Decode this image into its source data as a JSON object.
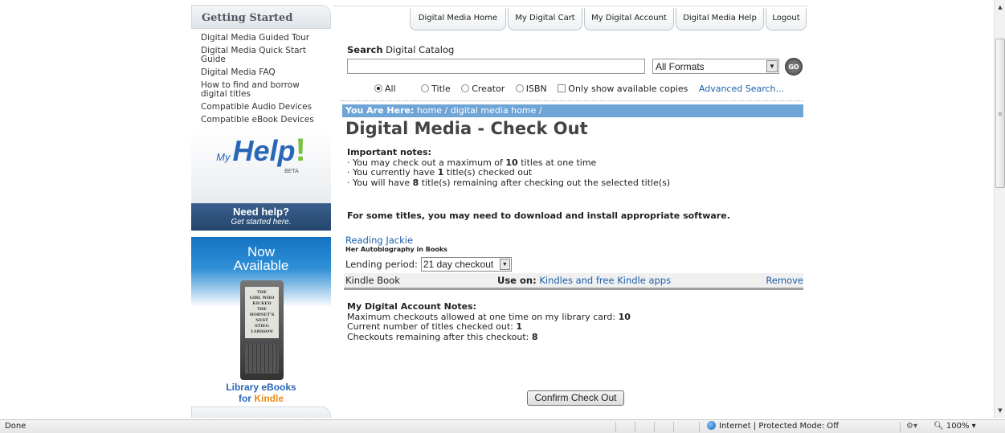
{
  "sidebar": {
    "getting_started_title": "Getting Started",
    "links": [
      "Digital Media Guided Tour",
      "Digital Media Quick Start Guide",
      "Digital Media FAQ",
      "How to find and borrow digital titles",
      "Compatible Audio Devices",
      "Compatible eBook Devices"
    ],
    "myhelp": {
      "my": "My",
      "help": "Help",
      "bang": "!",
      "beta": "BETA",
      "need_help": "Need help?",
      "get_started": "Get started here."
    },
    "kindle_ad": {
      "now": "Now",
      "available": "Available",
      "book_lines": [
        "THE",
        "GIRL WHO",
        "KICKED",
        "THE HORNET'S",
        "NEST",
        "STIEG LARSSON"
      ],
      "library_ebooks": "Library eBooks",
      "for": "for ",
      "kindle": "Kindle"
    }
  },
  "nav_tabs": [
    "Digital Media Home",
    "My Digital Cart",
    "My Digital Account",
    "Digital Media Help",
    "Logout"
  ],
  "search": {
    "label_bold": "Search",
    "label_rest": " Digital Catalog",
    "value": "",
    "format": "All Formats",
    "go": "GO",
    "options": {
      "all": "All",
      "title": "Title",
      "creator": "Creator",
      "isbn": "ISBN"
    },
    "available_only": "Only show available copies",
    "advanced": "Advanced Search..."
  },
  "breadcrumb": {
    "prefix": "You Are Here:",
    "path": " home / digital media home /"
  },
  "page_title": "Digital Media - Check Out",
  "notes": {
    "heading": "Important notes:",
    "l1a": "· You may check out a maximum of ",
    "l1b": "10",
    "l1c": " titles at one time",
    "l2a": "· You currently have ",
    "l2b": "1",
    "l2c": " title(s) checked out",
    "l3a": "· You will have ",
    "l3b": "8",
    "l3c": " title(s) remaining after checking out the selected title(s)"
  },
  "software_note": "For some titles, you may need to download and install appropriate software.",
  "item": {
    "title": "Reading Jackie",
    "subtitle": "Her Autobiography in Books",
    "lending_label": "Lending period:",
    "lending_value": "21 day checkout",
    "format": "Kindle Book",
    "use_on_label": "Use on:",
    "use_on_value": " Kindles and free Kindle apps",
    "remove": "Remove"
  },
  "account_notes": {
    "heading": "My Digital Account Notes:",
    "max_label": "Maximum checkouts allowed at one time on my library card: ",
    "max": "10",
    "current_label": "Current number of titles checked out: ",
    "current": "1",
    "remaining_label": "Checkouts remaining after this checkout: ",
    "remaining": "8"
  },
  "confirm_button": "Confirm Check Out",
  "browser": {
    "status": "Done",
    "zone": "Internet | Protected Mode: Off",
    "zoom": "100%",
    "zoom_icon": "zoom-magnifier-icon"
  }
}
